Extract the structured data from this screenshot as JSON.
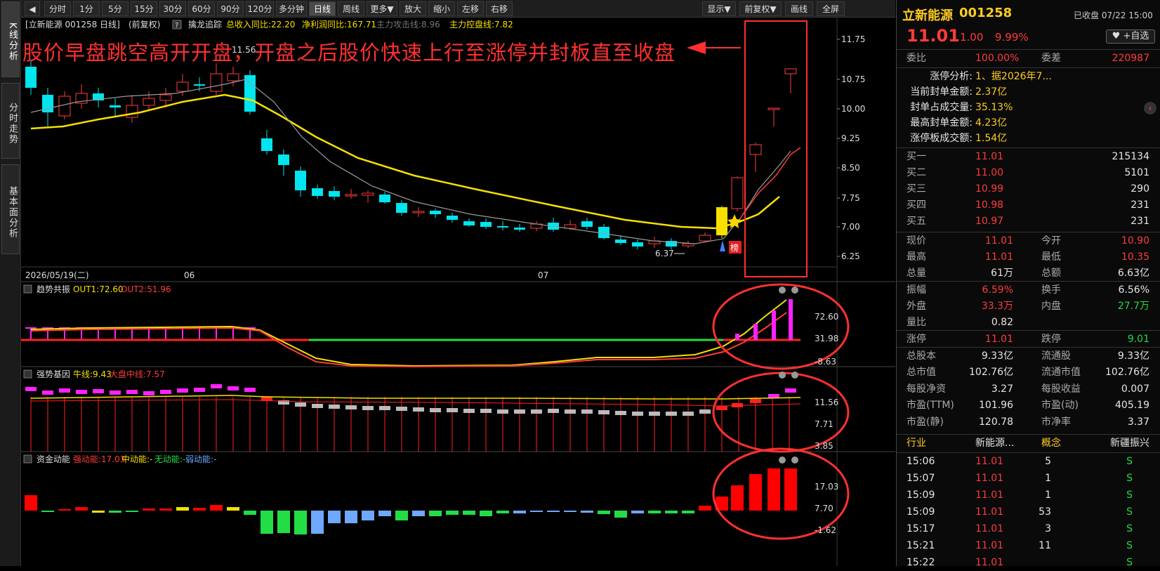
{
  "sidebar": {
    "tabs": [
      "K线分析",
      "分时走势",
      "基本面分析"
    ]
  },
  "toolbar": {
    "back_icon": "back-arrow-icon",
    "left": [
      "分时",
      "1分",
      "5分",
      "15分",
      "30分",
      "60分",
      "90分",
      "120分",
      "多分钟",
      "日线",
      "周线",
      "更多▼",
      "放大",
      "缩小",
      "左移",
      "右移"
    ],
    "right": [
      "显示▼",
      "前复权▼",
      "画线",
      "全屏"
    ],
    "active": "日线"
  },
  "main": {
    "header": {
      "name": "[立新能源 001258 日线]",
      "adj": "(前复权)",
      "help": "?",
      "indicator": "擒龙追踪",
      "s1": "总收入同比:22.20",
      "s2": "净利润同比:167.71",
      "s3": "主力攻击线:8.96",
      "s4": "主力控盘线:7.82"
    },
    "annotation": "股价早盘跳空高开开盘，开盘之后股价快速上行至涨停并封板直至收盘",
    "price_axis": [
      "11.75",
      "10.75",
      "10.00",
      "9.25",
      "8.50",
      "7.75",
      "7.00",
      "6.25"
    ],
    "low_label": "6.37",
    "high_label": "11.56",
    "dates": [
      "2026/05/19(二)",
      "06",
      "07"
    ],
    "badge": "榜"
  },
  "panels": {
    "trend": {
      "title": "趋势共振",
      "o1": "OUT1:72.60",
      "o2": "OUT2:51.96",
      "axis": [
        "72.60",
        "31.98",
        "-8.63"
      ]
    },
    "strong": {
      "title": "强势基因",
      "l1": "牛线:9.43",
      "l2": "大盘中线:7.57",
      "axis": [
        "11.56",
        "7.71",
        "3.85"
      ]
    },
    "capital": {
      "title": "资金动能",
      "l1": "强动能:17.03",
      "l2": "中动能:-",
      "l3": "无动能:-",
      "l4": "弱动能:-",
      "axis": [
        "17.03",
        "7.70",
        "-1.62"
      ]
    }
  },
  "stock": {
    "name": "立新能源",
    "code": "001258",
    "status": "已收盘 07/22 15:00",
    "price": "11.01",
    "change": "1.00",
    "pct": "9.99%",
    "watch": "+自选"
  },
  "webi": {
    "l1": "委比",
    "v1": "100.00%",
    "l2": "委差",
    "v2": "220987"
  },
  "limit": {
    "rows": [
      [
        "涨停分析:",
        "1、据2026年7..."
      ],
      [
        "当前封单金额:",
        "2.37亿"
      ],
      [
        "封单占成交量:",
        "35.13%"
      ],
      [
        "最高封单金额:",
        "4.23亿"
      ],
      [
        "涨停板成交额:",
        "1.54亿"
      ]
    ]
  },
  "bids": [
    [
      "买一",
      "11.01",
      "215134"
    ],
    [
      "买二",
      "11.00",
      "5101"
    ],
    [
      "买三",
      "10.99",
      "290"
    ],
    [
      "买四",
      "10.98",
      "231"
    ],
    [
      "买五",
      "10.97",
      "231"
    ]
  ],
  "quote": [
    [
      "现价",
      "11.01",
      "今开",
      "10.90"
    ],
    [
      "最高",
      "11.01",
      "最低",
      "10.35"
    ],
    [
      "总量",
      "61万",
      "总额",
      "6.63亿"
    ],
    [
      "振幅",
      "6.59%",
      "换手",
      "6.56%"
    ],
    [
      "外盘",
      "33.3万",
      "内盘",
      "27.7万"
    ],
    [
      "量比",
      "0.82",
      "",
      ""
    ],
    [
      "涨停",
      "11.01",
      "跌停",
      "9.01"
    ],
    [
      "总股本",
      "9.33亿",
      "流通股",
      "9.33亿"
    ],
    [
      "总市值",
      "102.76亿",
      "流通市值",
      "102.76亿"
    ],
    [
      "每股净资",
      "3.27",
      "每股收益",
      "0.007"
    ],
    [
      "市盈(TTM)",
      "101.96",
      "市盈(动)",
      "405.19"
    ],
    [
      "市盈(静)",
      "120.78",
      "市净率",
      "3.37"
    ]
  ],
  "industry": {
    "l1": "行业",
    "v1": "新能源...",
    "l2": "概念",
    "v2": "新疆振兴"
  },
  "ticks": [
    [
      "15:06",
      "11.01",
      "5",
      "S"
    ],
    [
      "15:07",
      "11.01",
      "1",
      "S"
    ],
    [
      "15:09",
      "11.01",
      "1",
      "S"
    ],
    [
      "15:09",
      "11.01",
      "53",
      "S"
    ],
    [
      "15:17",
      "11.01",
      "3",
      "S"
    ],
    [
      "15:21",
      "11.01",
      "11",
      "S"
    ],
    [
      "15:22",
      "11.01",
      "",
      "S"
    ]
  ],
  "colors": {
    "up": "#ff3b3b",
    "down": "#00e5ee",
    "ma_yellow": "#f5e000",
    "ma_gray": "#9a9a9a",
    "green": "#22dd44",
    "magenta": "#ff22ff"
  }
}
